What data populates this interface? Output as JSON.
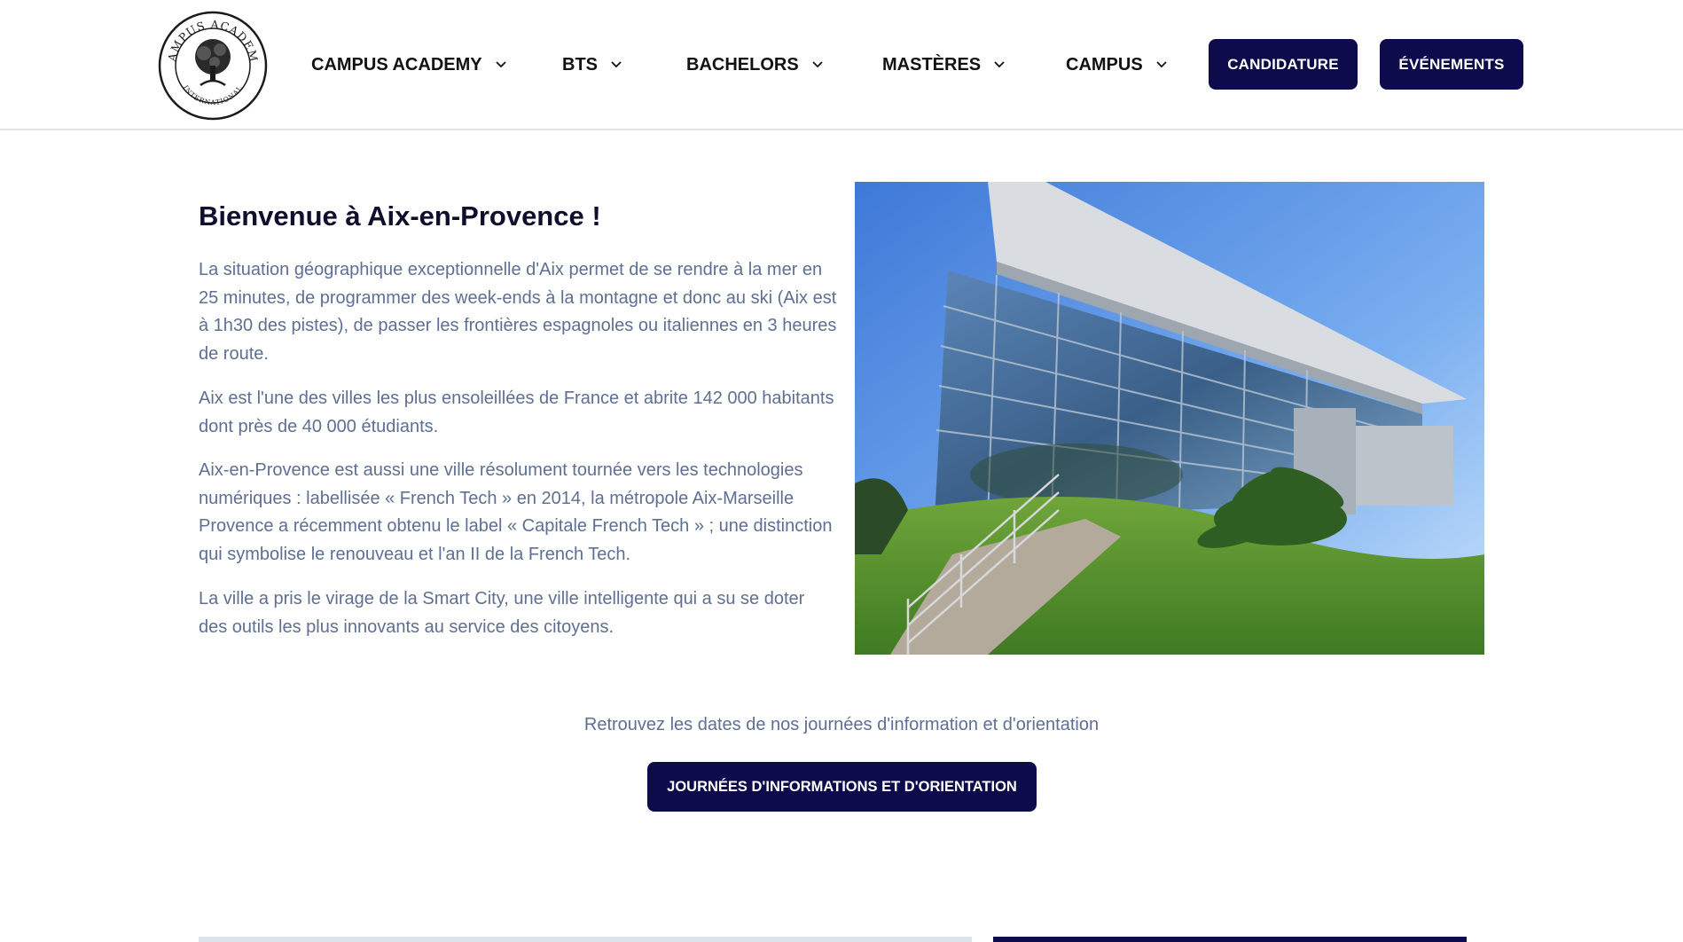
{
  "header": {
    "logo": {
      "top_text": "CAMPUS ACADEMY",
      "bottom_text": "INTERNATIONAL"
    },
    "nav": [
      {
        "label": "CAMPUS ACADEMY",
        "icon": "chevron-down-icon"
      },
      {
        "label": "BTS",
        "icon": "chevron-down-icon"
      },
      {
        "label": "BACHELORS",
        "icon": "chevron-down-icon"
      },
      {
        "label": "MASTÈRES",
        "icon": "chevron-down-icon"
      },
      {
        "label": "CAMPUS",
        "icon": "chevron-down-icon"
      }
    ],
    "buttons": {
      "candidature": "CANDIDATURE",
      "evenements": "ÉVÉNEMENTS"
    }
  },
  "main": {
    "title": "Bienvenue à Aix-en-Provence !",
    "paragraphs": [
      "La situation géographique exceptionnelle d'Aix permet de se rendre à la mer en 25 minutes, de programmer des week-ends à la montagne et donc au ski (Aix est à 1h30 des pistes), de passer les frontières espagnoles ou italiennes en 3 heures de route.",
      "Aix est l'une des villes les plus ensoleillées de France et abrite 142 000 habitants dont près de 40 000 étudiants.",
      "Aix-en-Provence est aussi une ville résolument tournée vers les technologies numériques : labellisée « French Tech » en 2014, la métropole Aix-Marseille Provence a récemment obtenu le label « Capitale French Tech » ; une distinction qui symbolise le renouveau et l'an II de la French Tech.",
      "La ville a pris le virage de la Smart City, une ville intelligente qui a su se doter des outils les plus innovants au service des citoyens."
    ],
    "cta": {
      "text": "Retrouvez les dates de nos journées d'information et d'orientation",
      "button": "JOURNÉES D'INFORMATIONS ET D'ORIENTATION"
    }
  },
  "colors": {
    "brand": "#0e0b4d",
    "body_text": "#5f6f93",
    "heading": "#0f0e2e"
  }
}
